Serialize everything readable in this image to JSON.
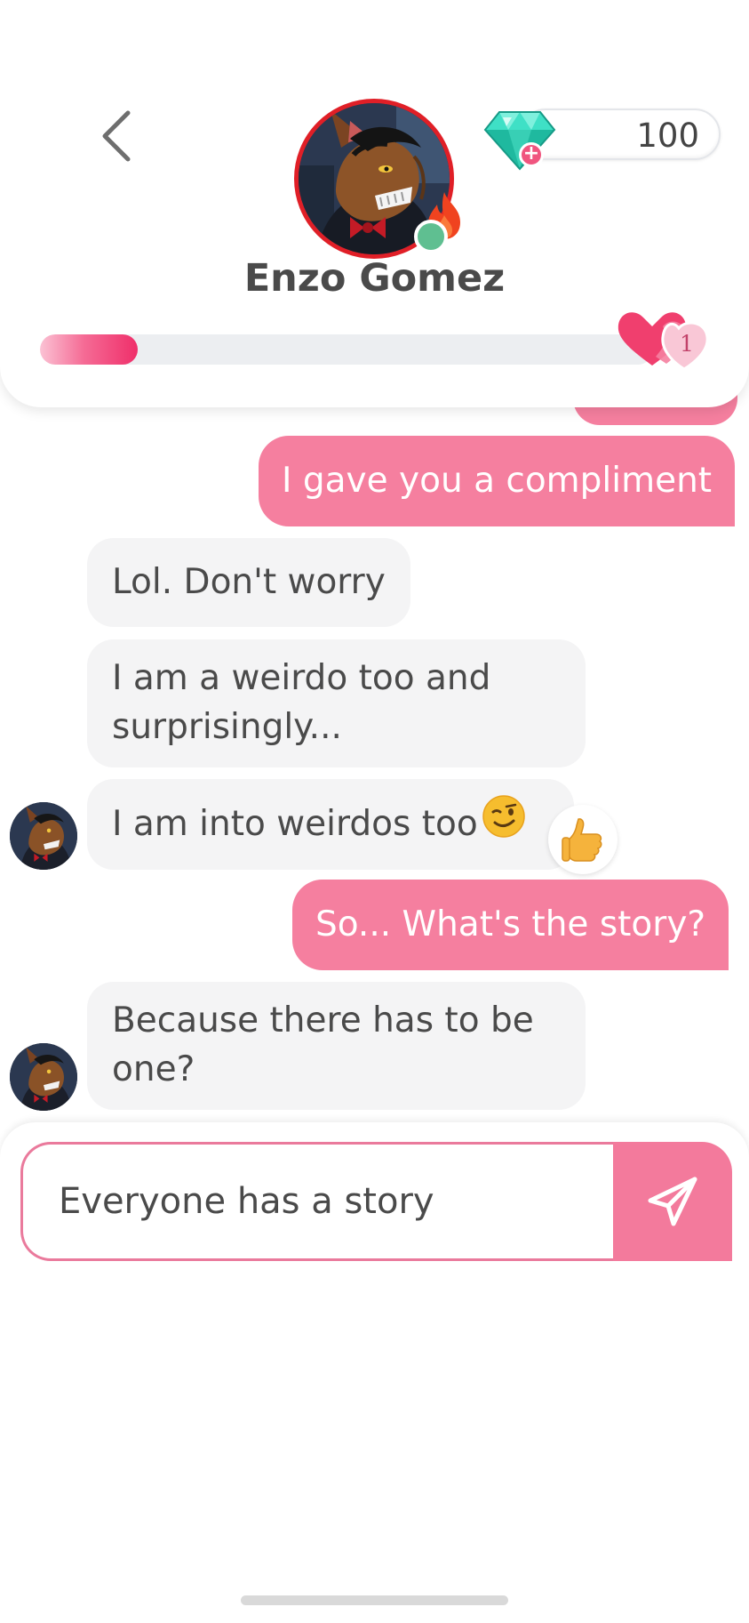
{
  "header": {
    "contact_name": "Enzo Gomez",
    "gems": "100",
    "hearts_count": "1",
    "affinity_progress": 0.16
  },
  "messages": [
    {
      "from": "me",
      "text": "I gave you a compliment"
    },
    {
      "from": "them",
      "text": "Lol. Don't worry"
    },
    {
      "from": "them",
      "lines": [
        "I am a weirdo too and",
        "surprisingly..."
      ]
    },
    {
      "from": "them",
      "text": "I am into weirdos too",
      "emoji": "winking-face",
      "reaction": "thumbs-up"
    },
    {
      "from": "me",
      "text": "So... What's the story?"
    },
    {
      "from": "them",
      "lines": [
        "Because there has to be",
        "one?"
      ]
    }
  ],
  "composer": {
    "value": "Everyone has a story"
  },
  "colors": {
    "accent_pink": "#f57f9f",
    "avatar_ring": "#e01f27",
    "online": "#5fbf91",
    "incoming_bubble": "#f4f4f5"
  },
  "icons": {
    "back": "chevron-left-icon",
    "gem": "diamond-icon",
    "send": "paper-plane-icon",
    "fire": "fire-icon",
    "hearts": "hearts-icon"
  }
}
